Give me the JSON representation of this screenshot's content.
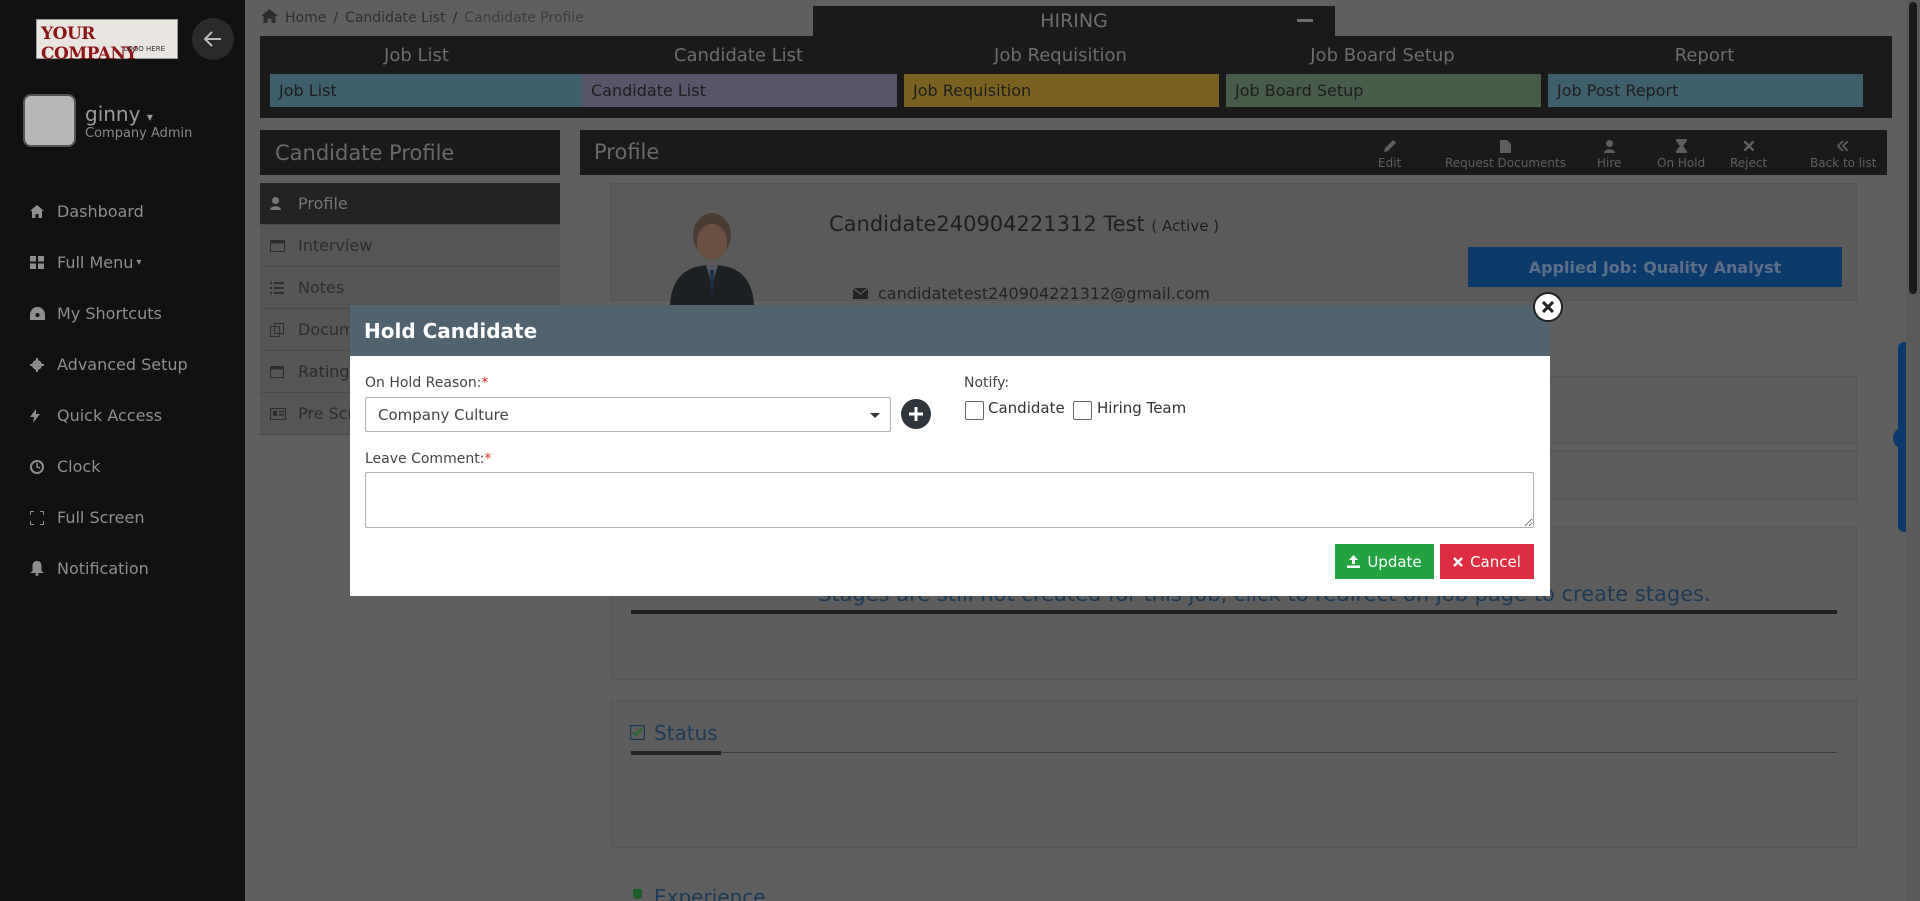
{
  "sidebar": {
    "logo_line1": "YOUR COMPANY",
    "logo_line2": "LOGO HERE",
    "user_name": "ginny",
    "user_role": "Company Admin",
    "items": [
      {
        "label": "Dashboard",
        "icon": "home-icon"
      },
      {
        "label": "Full Menu",
        "icon": "grid-icon"
      },
      {
        "label": "My Shortcuts",
        "icon": "gauge-icon"
      },
      {
        "label": "Advanced Setup",
        "icon": "gear-icon"
      },
      {
        "label": "Quick Access",
        "icon": "bolt-icon"
      },
      {
        "label": "Clock",
        "icon": "clock-icon"
      },
      {
        "label": "Full Screen",
        "icon": "expand-icon"
      },
      {
        "label": "Notification",
        "icon": "bell-icon"
      }
    ]
  },
  "breadcrumb": {
    "home": "Home",
    "sep1": "/",
    "list": "Candidate List",
    "sep2": "/",
    "current": "Candidate Profile"
  },
  "hiring_title": "HIRING",
  "topnav": [
    {
      "title": "Job List",
      "sub": "Job List",
      "color": "#3d5f6c"
    },
    {
      "title": "Candidate List",
      "sub": "Candidate List",
      "color": "#58556a"
    },
    {
      "title": "Job Requisition",
      "sub": "Job Requisition",
      "color": "#7b6121"
    },
    {
      "title": "Job Board Setup",
      "sub": "Job Board Setup",
      "color": "#465c48"
    },
    {
      "title": "Report",
      "sub": "Job Post Report",
      "color": "#3d5f6c"
    }
  ],
  "candidate_profile": {
    "title": "Candidate Profile",
    "items": [
      "Profile",
      "Interview",
      "Notes",
      "Documents",
      "Ratings",
      "Pre Screening"
    ]
  },
  "profile": {
    "title": "Profile",
    "actions": [
      "Edit",
      "Request Documents",
      "Hire",
      "On Hold",
      "Reject",
      "Back to list"
    ],
    "name": "Candidate240904221312 Test",
    "status": "( Active )",
    "email": "candidatetest240904221312@gmail.com",
    "applied_job": "Applied Job: Quality Analyst",
    "stage_text": "Stages are still not created for this job, click to redirect on job page to create stages.",
    "status_title": "Status",
    "experience_title": "Experience"
  },
  "modal": {
    "title": "Hold Candidate",
    "reason_label": "On Hold Reason:",
    "required_mark": "*",
    "reason_value": "Company Culture",
    "notify_label": "Notify:",
    "notify_candidate": "Candidate",
    "notify_hiring_team": "Hiring Team",
    "comment_label": "Leave Comment:",
    "comment_value": "",
    "update_label": "Update",
    "cancel_label": "Cancel"
  },
  "colors": {
    "modal_header": "#526370",
    "update": "#23a241",
    "cancel": "#dd2d40"
  }
}
